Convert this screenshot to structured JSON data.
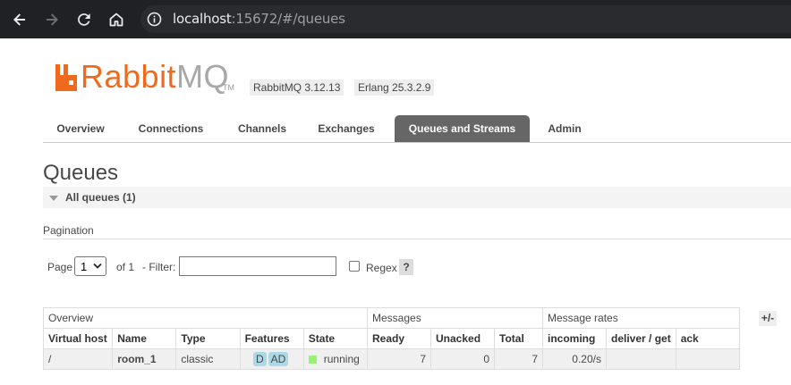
{
  "browser": {
    "url_host": "localhost",
    "url_rest": ":15672/#/queues",
    "back_icon": "arrow-left-icon",
    "forward_icon": "arrow-right-icon",
    "reload_icon": "reload-icon",
    "home_icon": "home-icon",
    "info_icon": "info-icon"
  },
  "header": {
    "logo_rabbit": "Rabbit",
    "logo_mq": "MQ",
    "logo_tm": "TM",
    "version_badge": "RabbitMQ 3.12.13",
    "erlang_badge": "Erlang 25.3.2.9"
  },
  "tabs": [
    {
      "label": "Overview",
      "active": false
    },
    {
      "label": "Connections",
      "active": false
    },
    {
      "label": "Channels",
      "active": false
    },
    {
      "label": "Exchanges",
      "active": false
    },
    {
      "label": "Queues and Streams",
      "active": true
    },
    {
      "label": "Admin",
      "active": false
    }
  ],
  "page": {
    "title": "Queues",
    "section_title": "All queues (1)",
    "pagination_label": "Pagination"
  },
  "filters": {
    "page_label": "Page",
    "page_value": "1",
    "of_label": "of 1",
    "filter_label": "- Filter:",
    "filter_value": "",
    "regex_label": "Regex",
    "help_label": "?"
  },
  "table": {
    "groups": [
      "Overview",
      "Messages",
      "Message rates"
    ],
    "columns": [
      "Virtual host",
      "Name",
      "Type",
      "Features",
      "State",
      "Ready",
      "Unacked",
      "Total",
      "incoming",
      "deliver / get",
      "ack"
    ],
    "rows": [
      {
        "vhost": "/",
        "name": "room_1",
        "type": "classic",
        "features": [
          "D",
          "AD"
        ],
        "state": "running",
        "ready": "7",
        "unacked": "0",
        "total": "7",
        "incoming": "0.20/s",
        "deliver_get": "",
        "ack": ""
      }
    ],
    "toggle_columns_label": "+/-"
  },
  "colors": {
    "brand_orange": "#f06a1d",
    "tab_active_bg": "#666666",
    "feature_badge": "#add8e6",
    "state_running": "#98f273"
  }
}
